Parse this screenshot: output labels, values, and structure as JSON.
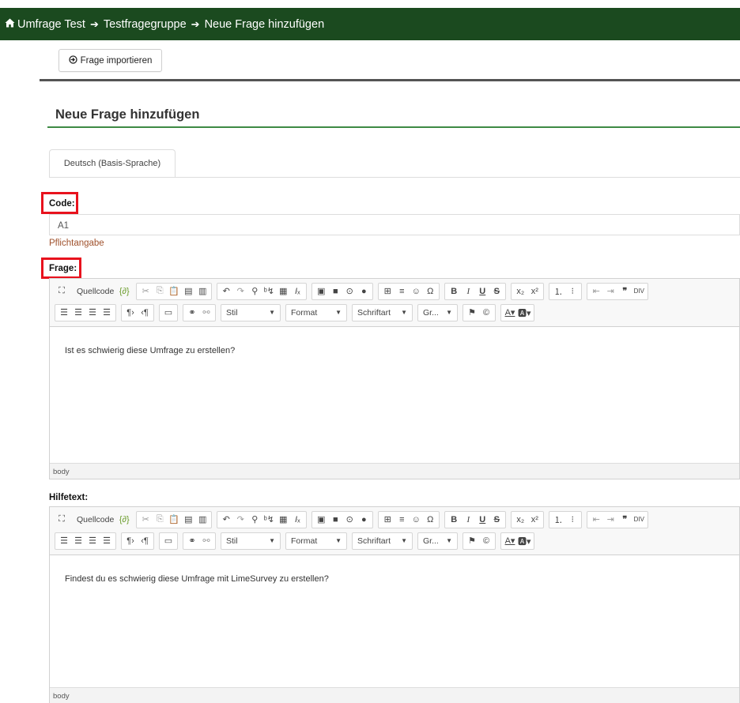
{
  "breadcrumb": {
    "items": [
      "Umfrage Test",
      "Testfragegruppe",
      "Neue Frage hinzufügen"
    ]
  },
  "toolbar": {
    "import_label": "Frage importieren"
  },
  "page": {
    "title": "Neue Frage hinzufügen"
  },
  "tabs": [
    {
      "label": "Deutsch (Basis-Sprache)",
      "active": true
    }
  ],
  "code": {
    "label": "Code:",
    "value": "A1",
    "required_note": "Pflichtangabe"
  },
  "question": {
    "label": "Frage:",
    "content": "Ist es schwierig diese Umfrage zu erstellen?",
    "status": "body"
  },
  "help": {
    "label": "Hilfetext:",
    "content": "Findest du es schwierig diese Umfrage mit LimeSurvey zu erstellen?",
    "status": "body"
  },
  "editor_toolbar": {
    "source": "Quellcode",
    "style": "Stil",
    "format": "Format",
    "font": "Schriftart",
    "size": "Gr..."
  },
  "colors": {
    "header_bg": "#1b4a1f",
    "accent_green": "#3e8a44",
    "highlight_red": "#e8121d",
    "required_text": "#a0522d"
  }
}
